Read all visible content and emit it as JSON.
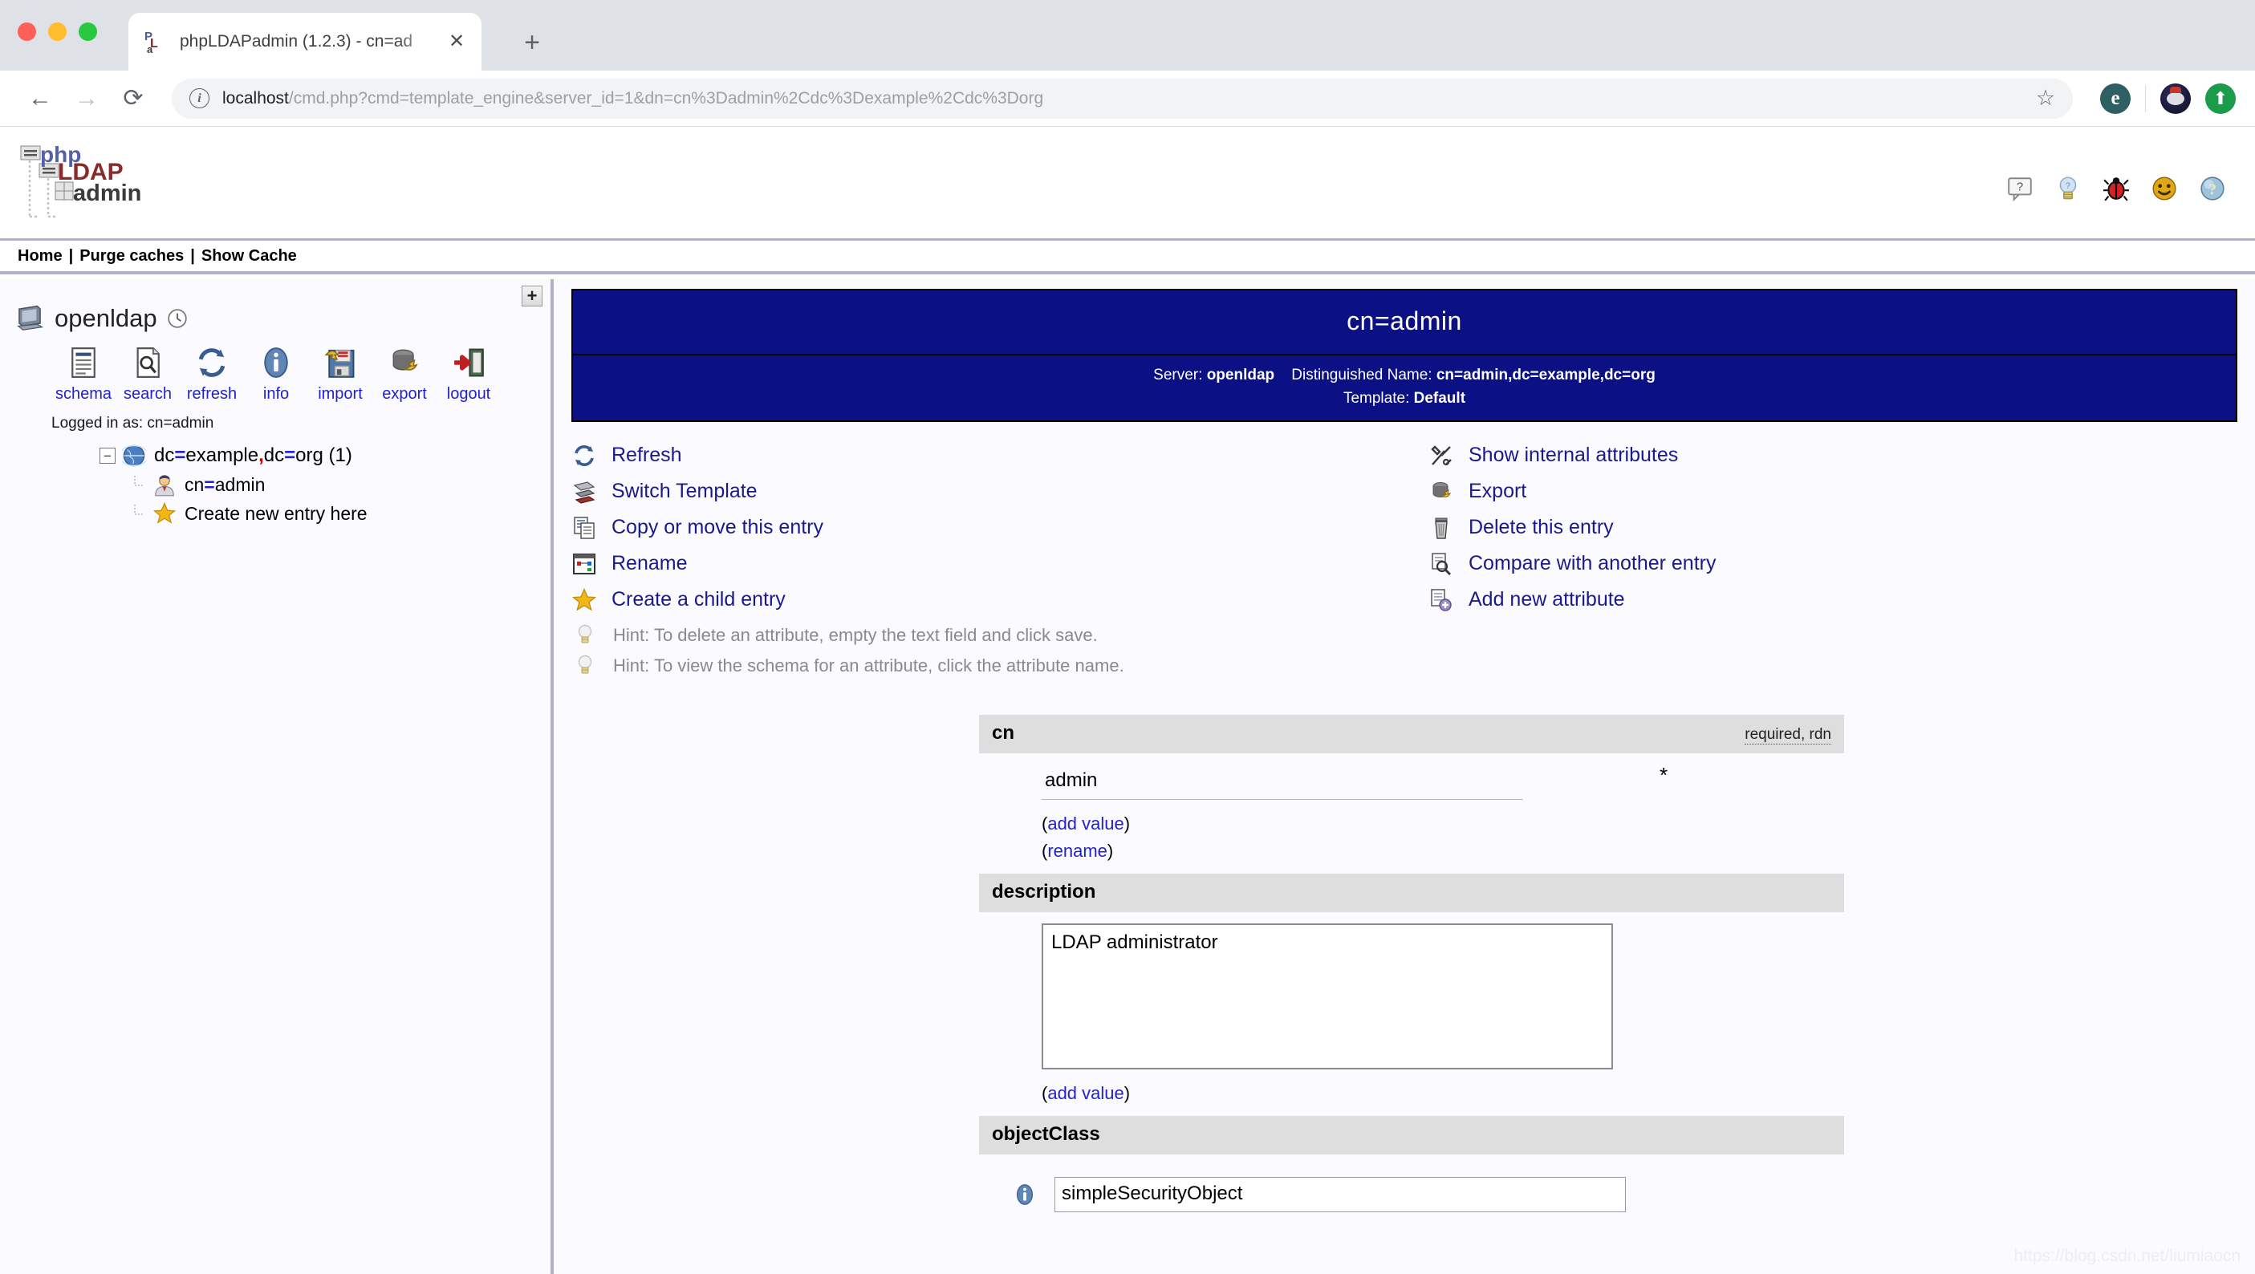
{
  "browser": {
    "tab_title": "phpLDAPadmin (1.2.3) - cn=ad",
    "tab_close_label": "✕",
    "new_tab_label": "+",
    "back_label": "←",
    "forward_label": "→",
    "reload_label": "⟳",
    "url_host": "localhost",
    "url_path": "/cmd.php?cmd=template_engine&server_id=1&dn=cn%3Dadmin%2Cdc%3Dexample%2Cdc%3Dorg",
    "star_label": "☆",
    "extension_label": "e",
    "update_label": "⬆"
  },
  "app": {
    "logo_php": "php",
    "logo_ldap": "LDAP",
    "logo_admin": "admin",
    "top_icons": [
      {
        "name": "help-balloon-icon",
        "title": "?"
      },
      {
        "name": "lightbulb-icon",
        "title": "Hints"
      },
      {
        "name": "bug-icon",
        "title": "Report a bug"
      },
      {
        "name": "smiley-icon",
        "title": "Feedback"
      },
      {
        "name": "question-globe-icon",
        "title": "Help"
      }
    ]
  },
  "nav": {
    "home": "Home",
    "purge": "Purge caches",
    "show_cache": "Show Cache",
    "separator": "|"
  },
  "sidebar": {
    "expand_label": "+",
    "server_name": "openldap",
    "logged_in_as": "Logged in as: cn=admin",
    "tools": [
      {
        "name": "schema",
        "label": "schema"
      },
      {
        "name": "search",
        "label": "search"
      },
      {
        "name": "refresh",
        "label": "refresh"
      },
      {
        "name": "info",
        "label": "info"
      },
      {
        "name": "import",
        "label": "import"
      },
      {
        "name": "export",
        "label": "export"
      },
      {
        "name": "logout",
        "label": "logout"
      }
    ],
    "tree": {
      "root_prefix": "dc",
      "root_text": "dc=example,dc=org (1)",
      "child_text": "cn=admin",
      "create_text": "Create new entry here",
      "collapse_label": "−"
    }
  },
  "entry": {
    "title": "cn=admin",
    "server_label": "Server:",
    "server_value": "openldap",
    "dn_label": "Distinguished Name:",
    "dn_value": "cn=admin,dc=example,dc=org",
    "template_label": "Template:",
    "template_value": "Default"
  },
  "actions_left": [
    {
      "icon": "refresh-icon",
      "label": "Refresh"
    },
    {
      "icon": "switch-template-icon",
      "label": "Switch Template"
    },
    {
      "icon": "copy-move-icon",
      "label": "Copy or move this entry"
    },
    {
      "icon": "rename-icon",
      "label": "Rename"
    },
    {
      "icon": "star-icon",
      "label": "Create a child entry"
    }
  ],
  "actions_right": [
    {
      "icon": "tools-icon",
      "label": "Show internal attributes"
    },
    {
      "icon": "export-icon",
      "label": "Export"
    },
    {
      "icon": "trash-icon",
      "label": "Delete this entry"
    },
    {
      "icon": "compare-icon",
      "label": "Compare with another entry"
    },
    {
      "icon": "add-attribute-icon",
      "label": "Add new attribute"
    }
  ],
  "hints": [
    "Hint: To delete an attribute, empty the text field and click save.",
    "Hint: To view the schema for an attribute, click the attribute name."
  ],
  "attributes": {
    "cn": {
      "name": "cn",
      "flags": "required, rdn",
      "value": "admin",
      "required_marker": "*",
      "add_value_label": "add value",
      "rename_label": "rename",
      "paren_open": "(",
      "paren_close": ")"
    },
    "description": {
      "name": "description",
      "value": "LDAP administrator",
      "add_value_label": "add value"
    },
    "objectClass": {
      "name": "objectClass",
      "value": "simpleSecurityObject"
    }
  },
  "watermark": "https://blog.csdn.net/liumiaocn"
}
